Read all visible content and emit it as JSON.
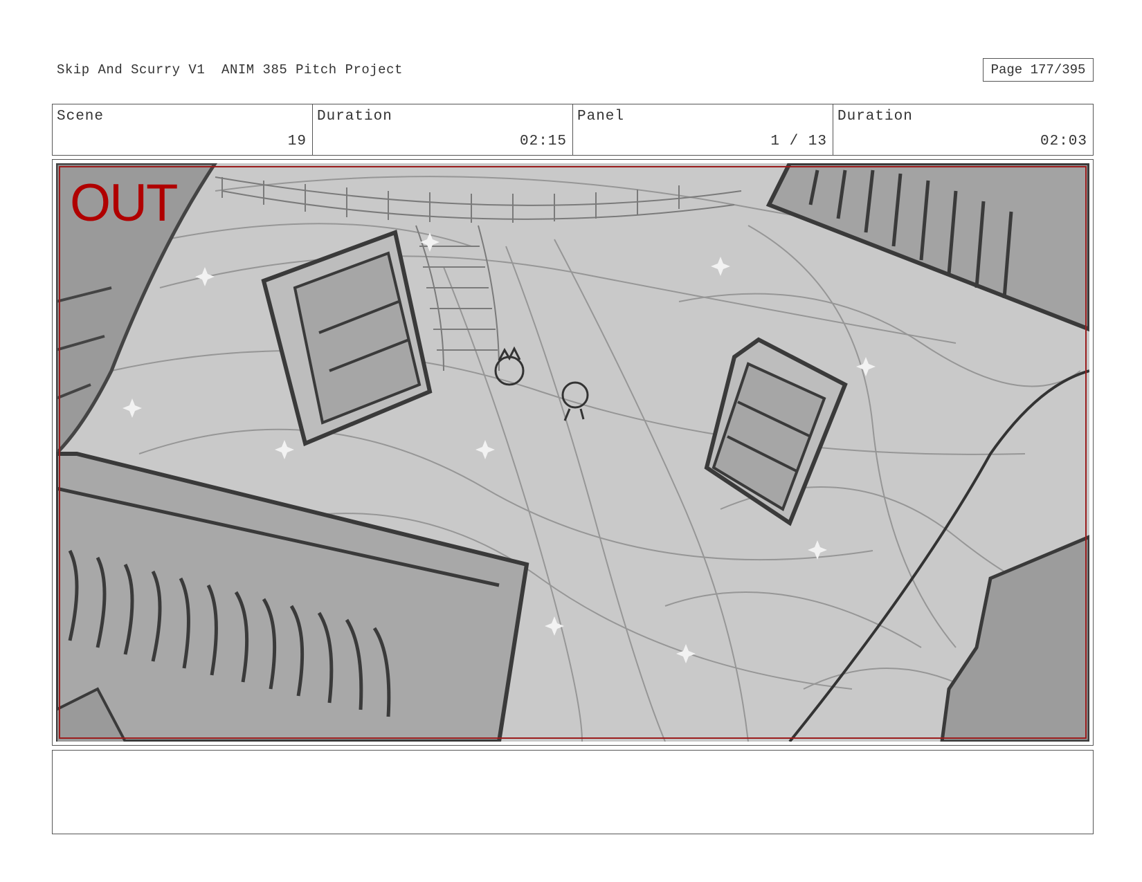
{
  "header": {
    "title": "Skip And Scurry V1  ANIM 385 Pitch Project",
    "page": "Page 177/395"
  },
  "info": {
    "scene_label": "Scene",
    "scene_value": "19",
    "duration_label": "Duration",
    "duration_value": "02:15",
    "panel_label": "Panel",
    "panel_value": "1 / 13",
    "panel_duration_label": "Duration",
    "panel_duration_value": "02:03"
  },
  "panel": {
    "overlay_text": "OUT",
    "overlay_color": "#b00000"
  },
  "notes": {
    "text": ""
  }
}
